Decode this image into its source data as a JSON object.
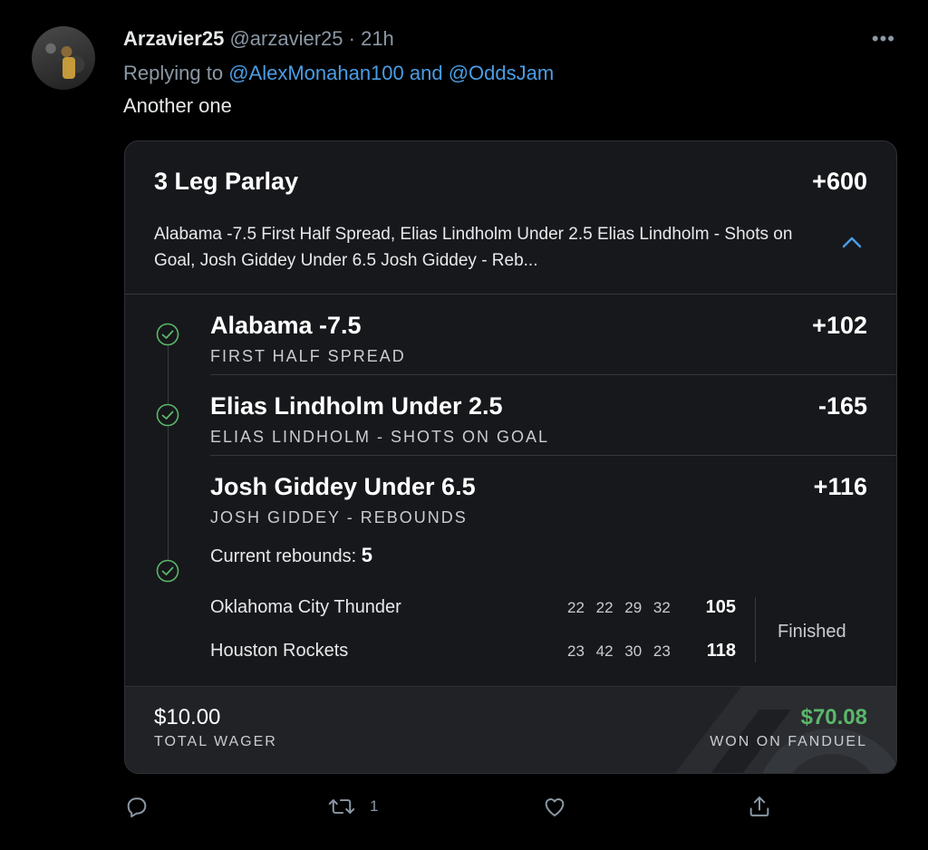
{
  "tweet": {
    "display_name": "Arzavier25",
    "handle": "@arzavier25",
    "separator": "·",
    "time": "21h",
    "replying_prefix": "Replying to ",
    "mention_1": "@AlexMonahan100",
    "mention_joiner": " and ",
    "mention_2": "@OddsJam",
    "text": "Another one",
    "more_label": "•••"
  },
  "bet": {
    "title": "3 Leg Parlay",
    "odds": "+600",
    "summary": "Alabama -7.5 First Half Spread, Elias Lindholm Under 2.5 Elias Lindholm - Shots on Goal, Josh Giddey Under 6.5 Josh Giddey - Reb...",
    "legs": [
      {
        "title": "Alabama -7.5",
        "subtitle": "FIRST HALF SPREAD",
        "odds": "+102",
        "status": "won"
      },
      {
        "title": "Elias Lindholm Under 2.5",
        "subtitle": "ELIAS LINDHOLM - SHOTS ON GOAL",
        "odds": "-165",
        "status": "won"
      },
      {
        "title": "Josh Giddey Under 6.5",
        "subtitle": "JOSH GIDDEY - REBOUNDS",
        "odds": "+116",
        "status": "won"
      }
    ],
    "current_stat_label": "Current rebounds: ",
    "current_stat_value": "5",
    "game": {
      "teams": [
        {
          "name": "Oklahoma City Thunder",
          "periods": "22 22 29 32",
          "final": "105"
        },
        {
          "name": "Houston Rockets",
          "periods": "23 42 30 23",
          "final": "118"
        }
      ],
      "status": "Finished"
    },
    "wager_amount": "$10.00",
    "wager_label": "TOTAL WAGER",
    "won_amount": "$70.08",
    "won_label": "WON ON FANDUEL"
  },
  "actions": {
    "reply_icon": "reply-icon",
    "retweet_icon": "retweet-icon",
    "retweet_count": "1",
    "like_icon": "heart-icon",
    "share_icon": "share-icon"
  },
  "colors": {
    "background": "#000000",
    "card": "#17181b",
    "accent_blue": "#4a9de4",
    "won_green": "#5bb86b",
    "check_green": "#5bb86b"
  }
}
